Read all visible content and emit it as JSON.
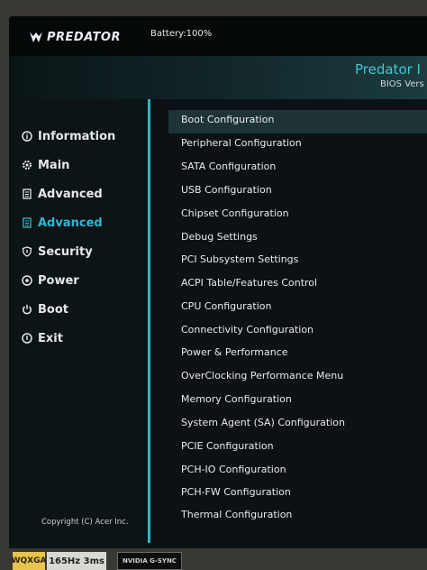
{
  "header": {
    "logo_text": "PREDATOR",
    "battery": "Battery:100%",
    "brand": "Predator I",
    "bios_version": "BIOS Vers"
  },
  "sidebar": {
    "items": [
      {
        "label": "Information",
        "icon": "info-icon",
        "active": false
      },
      {
        "label": "Main",
        "icon": "gear-icon",
        "active": false
      },
      {
        "label": "Advanced",
        "icon": "document-icon",
        "active": false
      },
      {
        "label": "Advanced",
        "icon": "document-icon",
        "active": true
      },
      {
        "label": "Security",
        "icon": "shield-icon",
        "active": false
      },
      {
        "label": "Power",
        "icon": "power-icon",
        "active": false
      },
      {
        "label": "Boot",
        "icon": "boot-icon",
        "active": false
      },
      {
        "label": "Exit",
        "icon": "exit-icon",
        "active": false
      }
    ],
    "copyright": "Copyright (C) Acer Inc."
  },
  "menu": {
    "selected_index": 0,
    "items": [
      "Boot Configuration",
      "Peripheral Configuration",
      "SATA Configuration",
      "USB Configuration",
      "Chipset Configuration",
      "Debug Settings",
      "PCI Subsystem Settings",
      "ACPI Table/Features Control",
      "CPU Configuration",
      "Connectivity Configuration",
      "Power & Performance",
      "OverClocking Performance Menu",
      "Memory Configuration",
      "System Agent (SA) Configuration",
      "PCIE Configuration",
      "PCH-IO Configuration",
      "PCH-FW Configuration",
      "Thermal Configuration"
    ]
  },
  "stickers": {
    "wqxga": "WQXGA",
    "refresh": "165Hz 3ms",
    "nvidia": "NVIDIA G-SYNC"
  },
  "colors": {
    "accent": "#2fb8c4",
    "highlight": "#1d3336",
    "background": "#0b1114",
    "text": "#e6ebec"
  }
}
